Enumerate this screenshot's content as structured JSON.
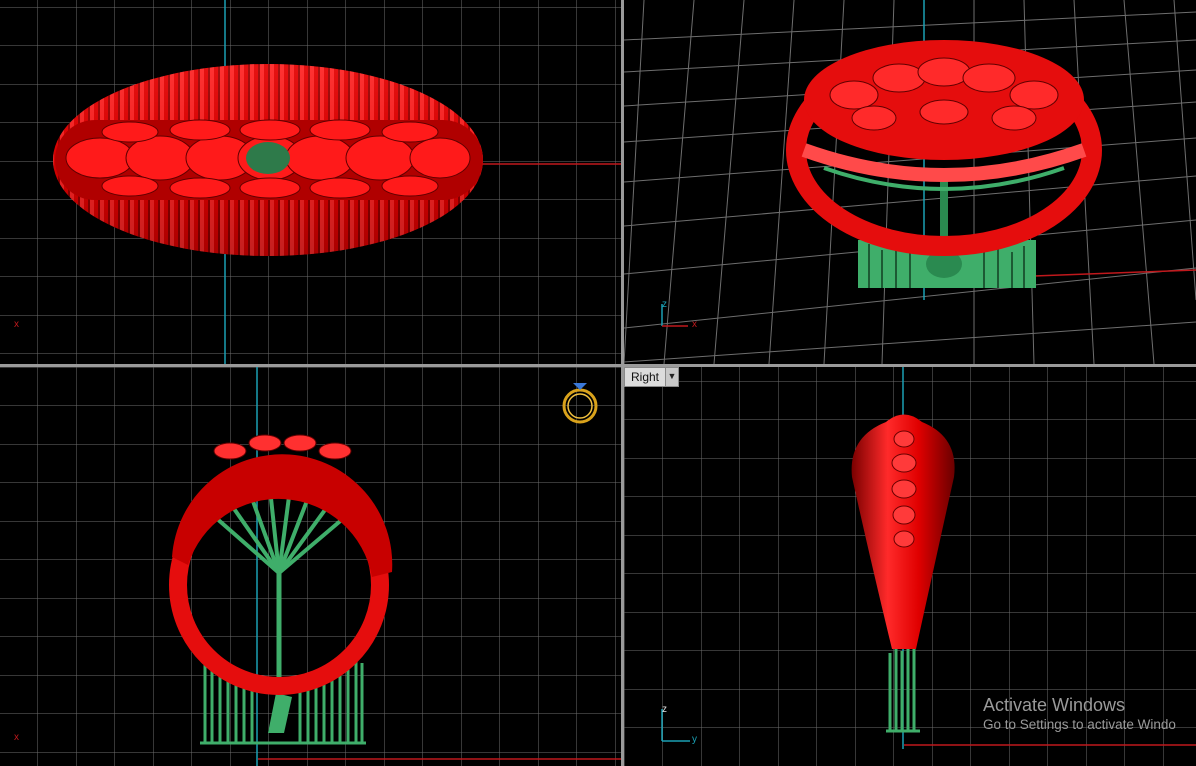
{
  "viewports": {
    "top_left": {
      "name": ""
    },
    "top_right": {
      "name": ""
    },
    "bottom_left": {
      "name": ""
    },
    "bottom_right": {
      "name": "Right",
      "menu_icon": "chevron-down-icon"
    }
  },
  "axes": {
    "x": "x",
    "y": "y",
    "z": "z"
  },
  "colors": {
    "background": "#000000",
    "grid": "#7a7a7a",
    "axis_x": "#c0181c",
    "axis_y": "#1aa0b4",
    "ring": "#e50d0d",
    "supports": "#3fae6a"
  },
  "watermark": {
    "title": "Activate Windows",
    "subtitle": "Go to Settings to activate Windo"
  }
}
